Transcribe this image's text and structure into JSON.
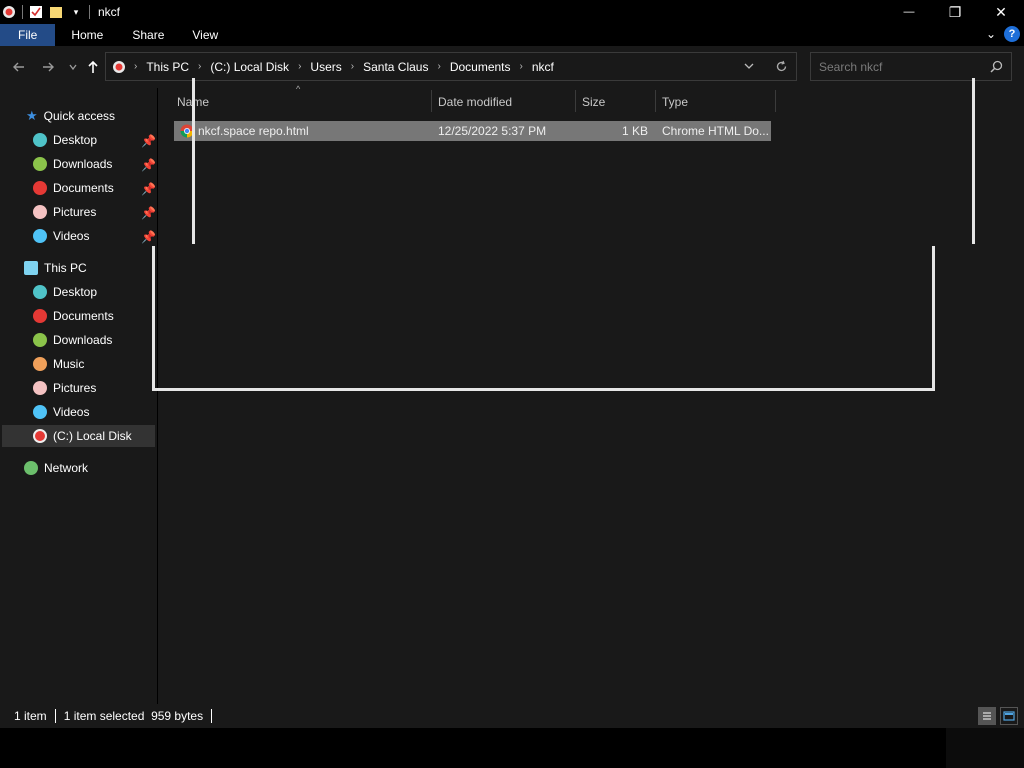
{
  "window": {
    "title": "nkcf",
    "controls": {
      "minimize": "—",
      "maximize": "❐",
      "close": "✕"
    }
  },
  "ribbon": {
    "tabs": [
      {
        "label": "File",
        "active": true
      },
      {
        "label": "Home"
      },
      {
        "label": "Share"
      },
      {
        "label": "View"
      }
    ],
    "help": "?"
  },
  "address_bar": {
    "breadcrumbs": [
      "This PC",
      "(C:) Local Disk",
      "Users",
      "Santa Claus",
      "Documents",
      "nkcf"
    ]
  },
  "search": {
    "placeholder": "Search nkcf"
  },
  "sidebar": {
    "quick_access": {
      "label": "Quick access",
      "items": [
        {
          "label": "Desktop",
          "pinned": true,
          "color": "#4fc3c8"
        },
        {
          "label": "Downloads",
          "pinned": true,
          "color": "#8bc34a"
        },
        {
          "label": "Documents",
          "pinned": true,
          "color": "#e53935"
        },
        {
          "label": "Pictures",
          "pinned": true,
          "color": "#f4c2c2"
        },
        {
          "label": "Videos",
          "pinned": true,
          "color": "#4fc3f7"
        }
      ]
    },
    "this_pc": {
      "label": "This PC",
      "items": [
        {
          "label": "Desktop",
          "color": "#4fc3c8"
        },
        {
          "label": "Documents",
          "color": "#e53935"
        },
        {
          "label": "Downloads",
          "color": "#8bc34a"
        },
        {
          "label": "Music",
          "color": "#f0a05a"
        },
        {
          "label": "Pictures",
          "color": "#f4c2c2"
        },
        {
          "label": "Videos",
          "color": "#4fc3f7"
        },
        {
          "label": "(C:) Local Disk",
          "color": "#e53935",
          "selected": true
        }
      ]
    },
    "network": {
      "label": "Network"
    }
  },
  "columns": [
    "Name",
    "Date modified",
    "Size",
    "Type"
  ],
  "files": [
    {
      "name": "nkcf.space repo.html",
      "date_modified": "12/25/2022 5:37 PM",
      "size": "1 KB",
      "type": "Chrome HTML Do...",
      "selected": true
    }
  ],
  "status": {
    "item_count": "1 item",
    "selection": "1 item selected  959 bytes"
  }
}
